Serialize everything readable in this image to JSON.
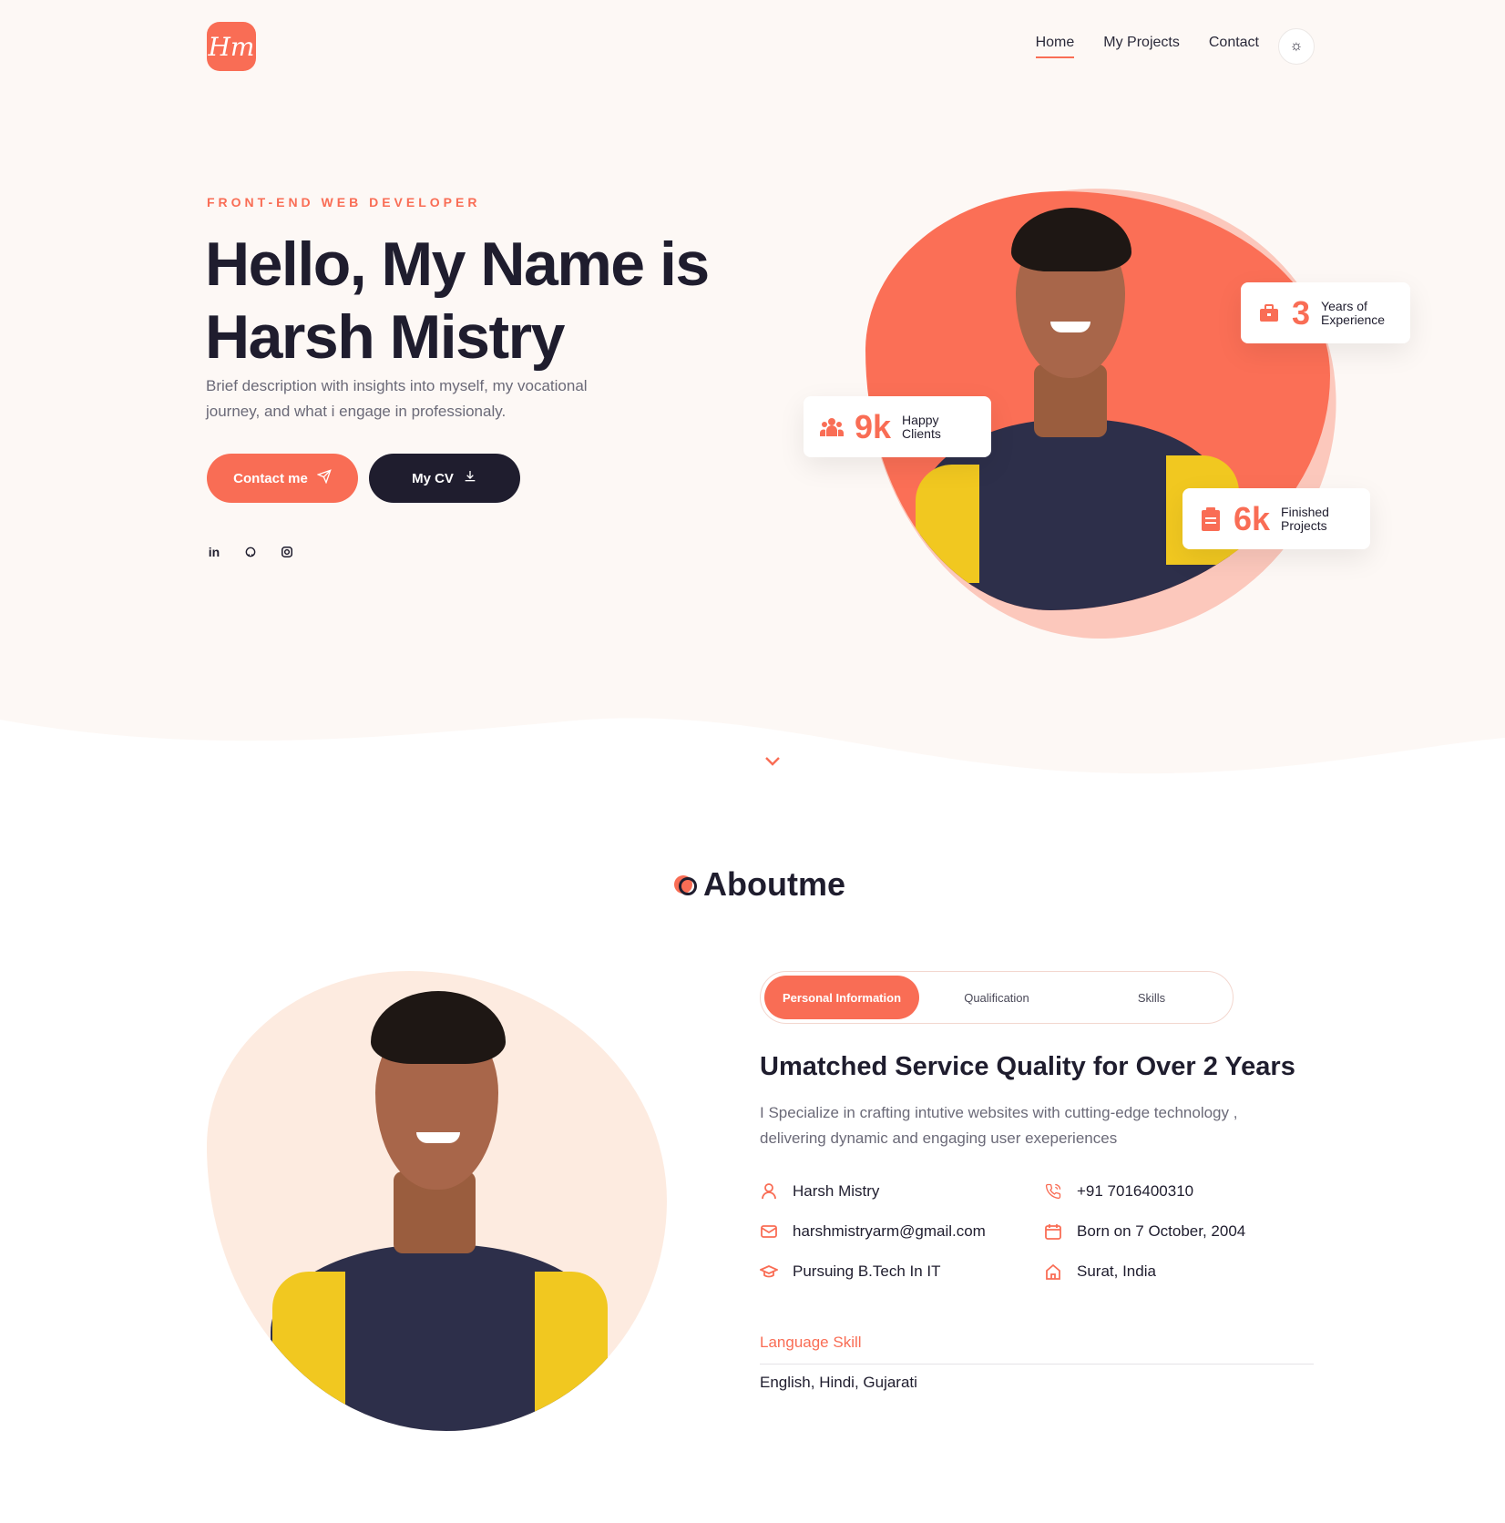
{
  "brand": {
    "logo_text": "Hm"
  },
  "nav": {
    "items": [
      {
        "label": "Home",
        "active": true
      },
      {
        "label": "My Projects",
        "active": false
      },
      {
        "label": "Contact",
        "active": false
      }
    ],
    "theme_icon": "sun-icon"
  },
  "hero": {
    "subtitle": "FRONT-END WEB DEVELOPER",
    "title_line1": "Hello, My Name is",
    "title_line2": "Harsh Mistry",
    "description": "Brief description with insights into myself, my vocational journey, and what i engage in professionaly.",
    "contact_button": "Contact me",
    "cv_button": "My CV",
    "socials": [
      "linkedin-icon",
      "github-icon",
      "instagram-icon"
    ],
    "stats": [
      {
        "value": "3",
        "label": "Years of Experience",
        "icon": "briefcase-icon"
      },
      {
        "value": "9k",
        "label": "Happy Clients",
        "icon": "users-icon"
      },
      {
        "value": "6k",
        "label": "Finished Projects",
        "icon": "clipboard-icon"
      }
    ]
  },
  "about": {
    "title": "Aboutme",
    "tabs": [
      {
        "label": "Personal Information",
        "active": true
      },
      {
        "label": "Qualification",
        "active": false
      },
      {
        "label": "Skills",
        "active": false
      }
    ],
    "heading": "Umatched Service Quality for Over 2 Years",
    "text": "I Specialize in crafting intutive websites with cutting-edge technology , delivering dynamic and engaging user exeperiences",
    "info": [
      {
        "icon": "user-icon",
        "text": "Harsh Mistry"
      },
      {
        "icon": "phone-icon",
        "text": "+91 7016400310"
      },
      {
        "icon": "mail-icon",
        "text": "harshmistryarm@gmail.com"
      },
      {
        "icon": "calendar-icon",
        "text": "Born on 7 October, 2004"
      },
      {
        "icon": "graduation-cap-icon",
        "text": "Pursuing B.Tech In IT"
      },
      {
        "icon": "home-icon",
        "text": "Surat, India"
      }
    ],
    "language_label": "Language Skill",
    "languages": "English, Hindi, Gujarati"
  },
  "colors": {
    "accent": "#f96d55",
    "dark": "#1f1d2e",
    "hero_bg": "#fdf8f5"
  }
}
